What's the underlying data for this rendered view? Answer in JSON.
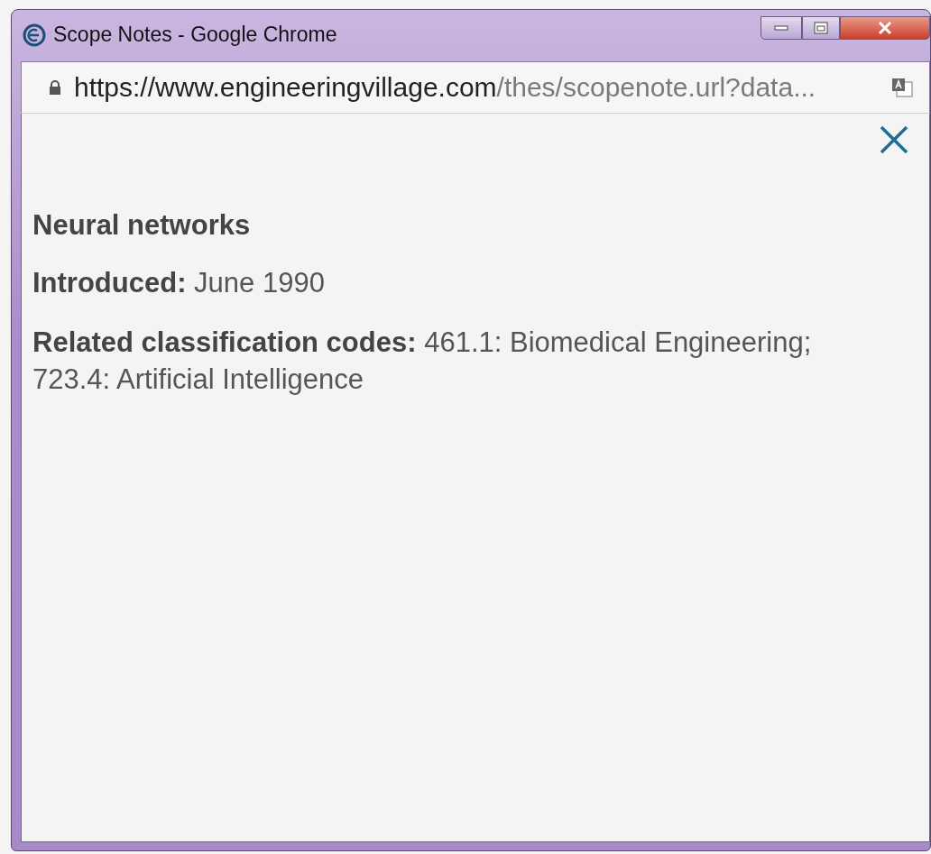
{
  "window": {
    "title": "Scope Notes - Google Chrome"
  },
  "address_bar": {
    "host": "https://www.engineeringvillage.com",
    "path": "/thes/scopenote.url?data..."
  },
  "content": {
    "heading": "Neural networks",
    "entries": [
      {
        "text": "**Introduced:** June 1990"
      },
      {
        "text": "**Related classification codes:** 461.1: Biomedical Engineering; 723.4: Artificial Intelligence"
      }
    ]
  }
}
